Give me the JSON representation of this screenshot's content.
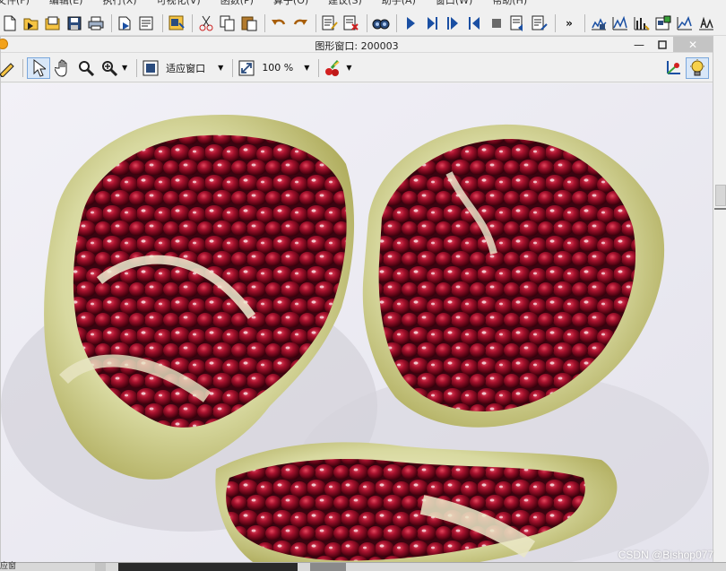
{
  "menu": [
    "文件(F)",
    "编辑(E)",
    "执行(X)",
    "可视化(V)",
    "函数(P)",
    "算子(O)",
    "建议(S)",
    "助手(A)",
    "窗口(W)",
    "帮助(H)"
  ],
  "graphics_window": {
    "title": "图形窗口: 200003",
    "zoom_mode": "适应窗口",
    "zoom_percent": "100 %"
  },
  "bottom_taskbar": [
    "应窗",
    "",
    ""
  ],
  "watermark": "CSDN @Bishop077",
  "colors": {
    "toolbar_bg": "#f0f0f0",
    "accent_blue": "#1a4fa3",
    "selected_tool": "#d8e7f8",
    "close_button": "#c4c4c4"
  }
}
